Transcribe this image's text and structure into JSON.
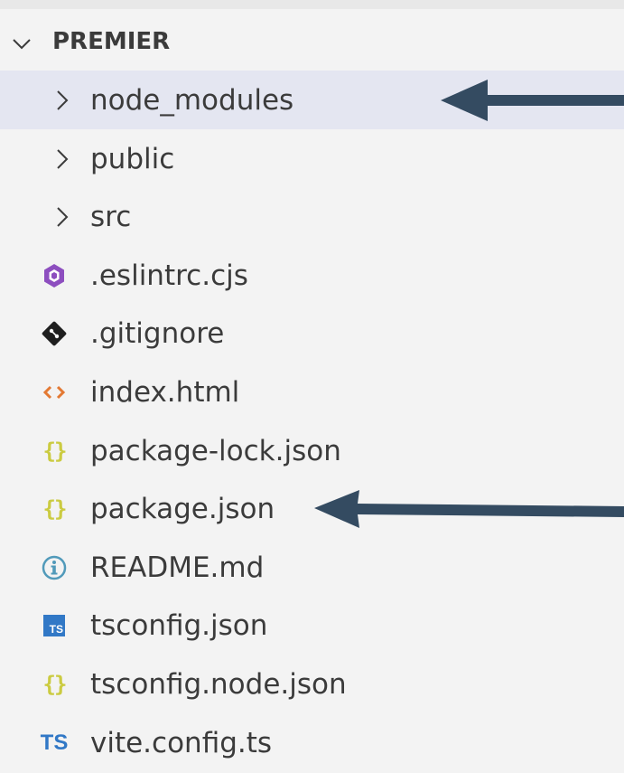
{
  "explorer": {
    "section_title": "PREMIER",
    "items": [
      {
        "label": "node_modules",
        "kind": "folder",
        "icon": "chevron-right-icon",
        "selected": true
      },
      {
        "label": "public",
        "kind": "folder",
        "icon": "chevron-right-icon"
      },
      {
        "label": "src",
        "kind": "folder",
        "icon": "chevron-right-icon"
      },
      {
        "label": ".eslintrc.cjs",
        "kind": "file",
        "icon": "eslint-icon"
      },
      {
        "label": ".gitignore",
        "kind": "file",
        "icon": "git-icon"
      },
      {
        "label": "index.html",
        "kind": "file",
        "icon": "html-icon"
      },
      {
        "label": "package-lock.json",
        "kind": "file",
        "icon": "json-icon"
      },
      {
        "label": "package.json",
        "kind": "file",
        "icon": "json-icon"
      },
      {
        "label": "README.md",
        "kind": "file",
        "icon": "info-icon"
      },
      {
        "label": "tsconfig.json",
        "kind": "file",
        "icon": "tsconfig-icon"
      },
      {
        "label": "tsconfig.node.json",
        "kind": "file",
        "icon": "json-icon"
      },
      {
        "label": "vite.config.ts",
        "kind": "file",
        "icon": "typescript-icon"
      }
    ]
  },
  "icons": {
    "json_glyph": "{}",
    "ts_box_glyph": "TS",
    "ts_text_glyph": "TS"
  },
  "colors": {
    "selected_row": "#e4e6f1",
    "annotation_arrow": "#344b61",
    "eslint": "#8d4ebf",
    "html": "#e37933",
    "json": "#cbcb41",
    "info": "#519aba",
    "typescript": "#3178c6"
  }
}
